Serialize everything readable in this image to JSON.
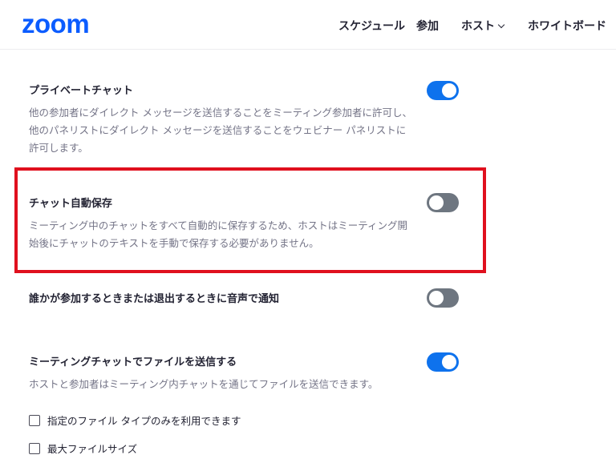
{
  "header": {
    "logo": "zoom",
    "nav": [
      {
        "label": "スケジュール",
        "has_dropdown": false
      },
      {
        "label": "参加",
        "has_dropdown": false
      },
      {
        "label": "ホスト",
        "has_dropdown": true
      },
      {
        "label": "ホワイトボード",
        "has_dropdown": false
      }
    ]
  },
  "settings": [
    {
      "title": "プライベートチャット",
      "description": "他の参加者にダイレクト メッセージを送信することをミーティング参加者に許可し、他のパネリストにダイレクト メッセージを送信することをウェビナー パネリストに許可します。",
      "enabled": true
    },
    {
      "title": "チャット自動保存",
      "description": "ミーティング中のチャットをすべて自動的に保存するため、ホストはミーティング開始後にチャットのテキストを手動で保存する必要がありません。",
      "enabled": false
    },
    {
      "title": "誰かが参加するときまたは退出するときに音声で通知",
      "enabled": false
    },
    {
      "title": "ミーティングチャットでファイルを送信する",
      "description": "ホストと参加者はミーティング内チャットを通じてファイルを送信できます。",
      "enabled": true,
      "options": [
        {
          "label": "指定のファイル タイプのみを利用できます",
          "checked": false
        },
        {
          "label": "最大ファイルサイズ",
          "checked": false
        }
      ]
    }
  ],
  "colors": {
    "brand": "#0b5cff",
    "toggle_on": "#0e72ed",
    "toggle_off": "#6e7680",
    "highlight": "#e0101e"
  }
}
